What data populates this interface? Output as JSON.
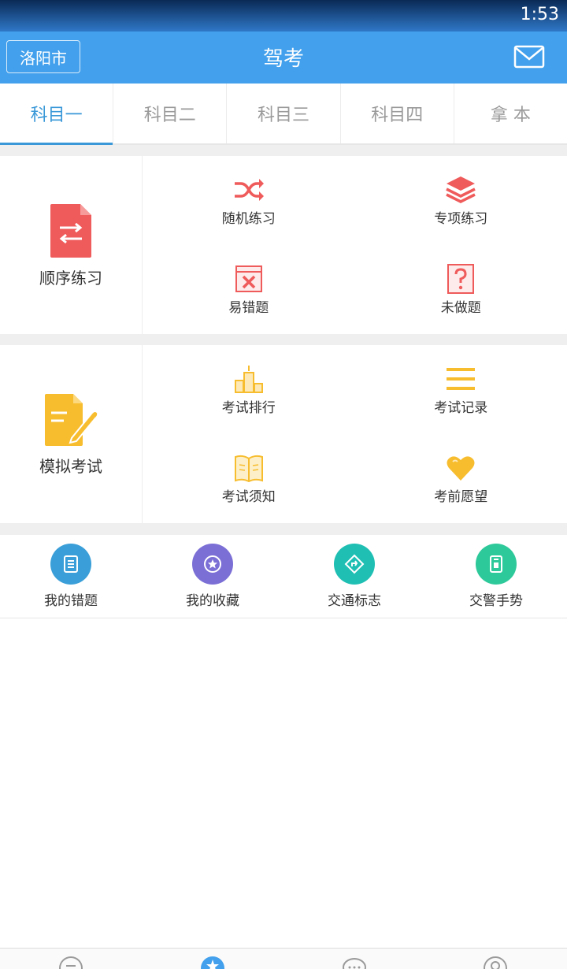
{
  "status": {
    "time": "1:53"
  },
  "header": {
    "city": "洛阳市",
    "title": "驾考"
  },
  "tabs": [
    {
      "label": "科目一",
      "active": true
    },
    {
      "label": "科目二",
      "active": false
    },
    {
      "label": "科目三",
      "active": false
    },
    {
      "label": "科目四",
      "active": false
    },
    {
      "label": "拿 本",
      "active": false
    }
  ],
  "practice": {
    "main": {
      "label": "顺序练习",
      "icon": "sequence-doc-icon"
    },
    "items": [
      {
        "label": "随机练习",
        "icon": "shuffle-icon"
      },
      {
        "label": "专项练习",
        "icon": "layers-icon"
      },
      {
        "label": "易错题",
        "icon": "wrong-icon"
      },
      {
        "label": "未做题",
        "icon": "question-icon"
      }
    ]
  },
  "exam": {
    "main": {
      "label": "模拟考试",
      "icon": "exam-doc-icon"
    },
    "items": [
      {
        "label": "考试排行",
        "icon": "podium-icon"
      },
      {
        "label": "考试记录",
        "icon": "list-icon"
      },
      {
        "label": "考试须知",
        "icon": "book-icon"
      },
      {
        "label": "考前愿望",
        "icon": "heart-icon"
      }
    ]
  },
  "shortcuts": [
    {
      "label": "我的错题",
      "icon": "notebook-icon",
      "color": "#3a9fd8"
    },
    {
      "label": "我的收藏",
      "icon": "star-icon",
      "color": "#7b6fd6"
    },
    {
      "label": "交通标志",
      "icon": "sign-icon",
      "color": "#1fbfb4"
    },
    {
      "label": "交警手势",
      "icon": "police-icon",
      "color": "#2ec99a"
    }
  ],
  "colors": {
    "primary": "#42a0ec",
    "accent": "#3a98d8",
    "red": "#ef5a5a",
    "yellow": "#f7bd2f"
  },
  "bottom_nav": [
    {
      "icon": "chat-doc-icon"
    },
    {
      "icon": "home-star-icon"
    },
    {
      "icon": "messages-icon"
    },
    {
      "icon": "user-icon"
    }
  ]
}
